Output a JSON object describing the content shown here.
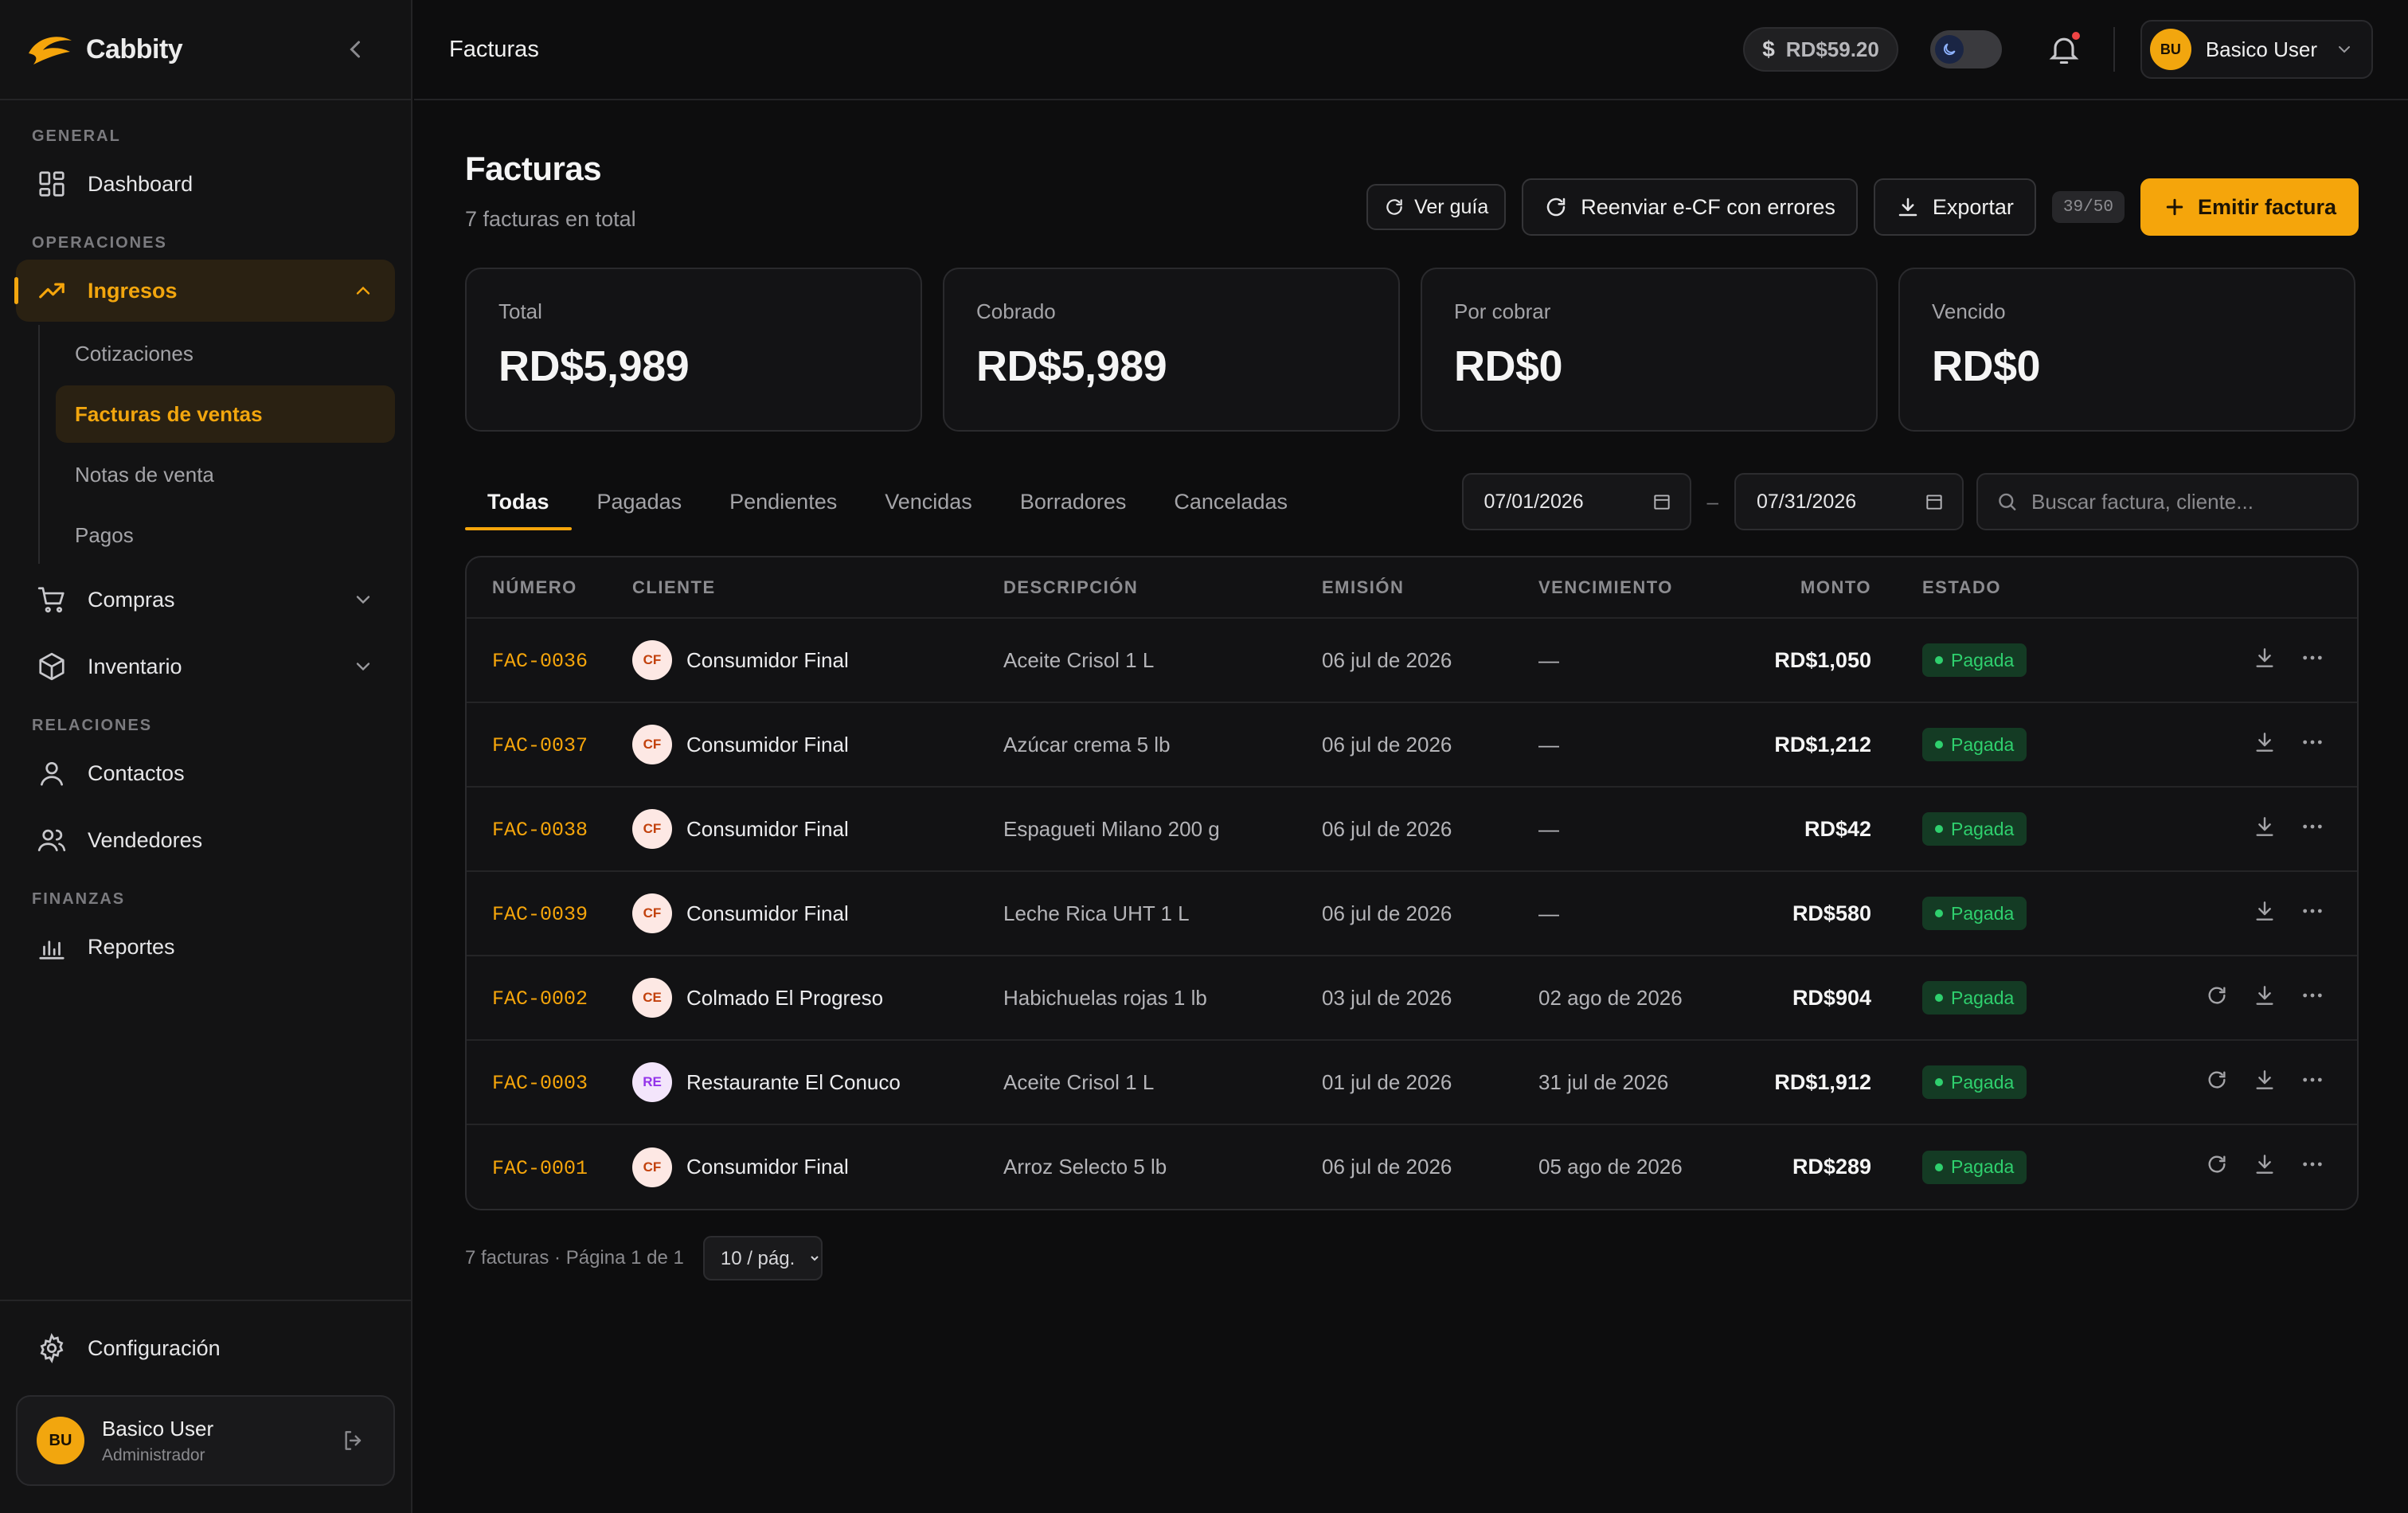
{
  "brand": {
    "name": "Cabbity"
  },
  "sidebar": {
    "sections": {
      "general": "GENERAL",
      "operaciones": "OPERACIONES",
      "relaciones": "RELACIONES",
      "finanzas": "FINANZAS"
    },
    "items": {
      "dashboard": "Dashboard",
      "ingresos": "Ingresos",
      "compras": "Compras",
      "inventario": "Inventario",
      "contactos": "Contactos",
      "vendedores": "Vendedores",
      "reportes": "Reportes",
      "configuracion": "Configuración"
    },
    "ingresos_sub": [
      "Cotizaciones",
      "Facturas de ventas",
      "Notas de venta",
      "Pagos"
    ],
    "user": {
      "initials": "BU",
      "name": "Basico User",
      "role": "Administrador"
    }
  },
  "topbar": {
    "title": "Facturas",
    "balance": "RD$59.20",
    "user_initials": "BU",
    "user_name": "Basico User"
  },
  "page": {
    "title": "Facturas",
    "subtitle": "7 facturas en total",
    "actions": {
      "guide": "Ver guía",
      "resend": "Reenviar e-CF con errores",
      "export": "Exportar",
      "counter": "39/50",
      "emit": "Emitir factura"
    }
  },
  "cards": [
    {
      "label": "Total",
      "value": "RD$5,989"
    },
    {
      "label": "Cobrado",
      "value": "RD$5,989"
    },
    {
      "label": "Por cobrar",
      "value": "RD$0"
    },
    {
      "label": "Vencido",
      "value": "RD$0"
    }
  ],
  "tabs": [
    "Todas",
    "Pagadas",
    "Pendientes",
    "Vencidas",
    "Borradores",
    "Canceladas"
  ],
  "filters": {
    "date_from": "07/01/2026",
    "date_sep": "–",
    "date_to": "07/31/2026",
    "search_placeholder": "Buscar factura, cliente..."
  },
  "table": {
    "columns": [
      "NÚMERO",
      "CLIENTE",
      "DESCRIPCIÓN",
      "EMISIÓN",
      "VENCIMIENTO",
      "MONTO",
      "ESTADO"
    ],
    "rows": [
      {
        "number": "FAC-0036",
        "initials": "CF",
        "client": "Consumidor Final",
        "description": "Aceite Crisol 1 L",
        "issued": "06 jul de 2026",
        "due": "—",
        "amount": "RD$1,050",
        "status": "Pagada"
      },
      {
        "number": "FAC-0037",
        "initials": "CF",
        "client": "Consumidor Final",
        "description": "Azúcar crema 5 lb",
        "issued": "06 jul de 2026",
        "due": "—",
        "amount": "RD$1,212",
        "status": "Pagada"
      },
      {
        "number": "FAC-0038",
        "initials": "CF",
        "client": "Consumidor Final",
        "description": "Espagueti Milano 200 g",
        "issued": "06 jul de 2026",
        "due": "—",
        "amount": "RD$42",
        "status": "Pagada"
      },
      {
        "number": "FAC-0039",
        "initials": "CF",
        "client": "Consumidor Final",
        "description": "Leche Rica UHT 1 L",
        "issued": "06 jul de 2026",
        "due": "—",
        "amount": "RD$580",
        "status": "Pagada"
      },
      {
        "number": "FAC-0002",
        "initials": "CE",
        "client": "Colmado El Progreso",
        "description": "Habichuelas rojas 1 lb",
        "issued": "03 jul de 2026",
        "due": "02 ago de 2026",
        "amount": "RD$904",
        "status": "Pagada"
      },
      {
        "number": "FAC-0003",
        "initials": "RE",
        "client": "Restaurante El Conuco",
        "description": "Aceite Crisol 1 L",
        "issued": "01 jul de 2026",
        "due": "31 jul de 2026",
        "amount": "RD$1,912",
        "status": "Pagada"
      },
      {
        "number": "FAC-0001",
        "initials": "CF",
        "client": "Consumidor Final",
        "description": "Arroz Selecto 5 lb",
        "issued": "06 jul de 2026",
        "due": "05 ago de 2026",
        "amount": "RD$289",
        "status": "Pagada"
      }
    ]
  },
  "pager": {
    "summary": "7 facturas · Página 1 de 1",
    "page_size": "10 / pág."
  },
  "colors": {
    "accent": "#f5a50b",
    "success": "#2fd06e",
    "background": "#0d0d0e"
  },
  "icons": [
    "logo-icon",
    "chevron-left-icon",
    "dashboard-icon",
    "trend-icon",
    "chevron-up-icon",
    "cart-icon",
    "box-icon",
    "chevron-down-icon",
    "user-icon",
    "users-icon",
    "chart-icon",
    "gear-icon",
    "logout-icon",
    "dollar-icon",
    "moon-icon",
    "bell-icon",
    "guide-icon",
    "refresh-icon",
    "download-icon",
    "plus-icon",
    "calendar-icon",
    "search-icon",
    "more-icon"
  ]
}
